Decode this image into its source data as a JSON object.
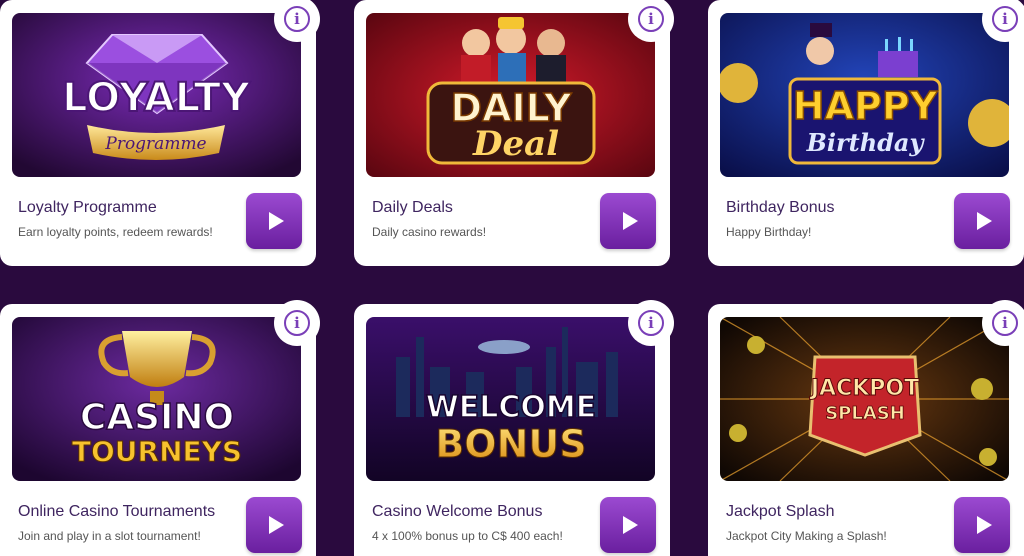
{
  "colors": {
    "background": "#2a0a3e",
    "accent": "#7a3fb8",
    "title": "#3f2560"
  },
  "cards": [
    {
      "title": "Loyalty Programme",
      "description": "Earn loyalty points, redeem rewards!",
      "banner_line1": "LOYALTY",
      "banner_line2": "Programme",
      "icon": "diamond-icon"
    },
    {
      "title": "Daily Deals",
      "description": "Daily casino rewards!",
      "banner_line1": "DAILY",
      "banner_line2": "Deal",
      "icon": "characters-art"
    },
    {
      "title": "Birthday Bonus",
      "description": "Happy Birthday!",
      "banner_line1": "HAPPY",
      "banner_line2": "Birthday",
      "icon": "cake-icon"
    },
    {
      "title": "Online Casino Tournaments",
      "description": "Join and play in a slot tournament!",
      "banner_line1": "CASINO",
      "banner_line2": "TOURNEYS",
      "icon": "trophy-icon"
    },
    {
      "title": "Casino Welcome Bonus",
      "description": "4 x 100% bonus up to C$ 400 each!",
      "banner_line1": "WELCOME",
      "banner_line2": "BONUS",
      "icon": "skyline-art"
    },
    {
      "title": "Jackpot Splash",
      "description": "Jackpot City Making a Splash!",
      "banner_line1": "JACKPOT",
      "banner_line2": "SPLASH",
      "icon": "badge-icon"
    }
  ],
  "info_glyph": "i"
}
